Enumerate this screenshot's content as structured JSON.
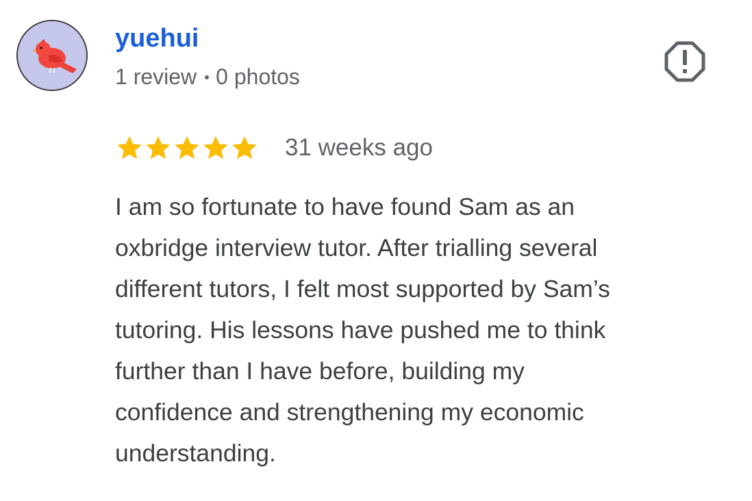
{
  "reviewer": {
    "name": "yuehui",
    "review_count": "1 review",
    "photo_count": "0 photos",
    "avatar": "red-bird-avatar"
  },
  "report": {
    "icon": "report-flag-icon",
    "color": "#5f6368"
  },
  "rating": {
    "stars": 5,
    "max": 5,
    "color": "#fbbc04",
    "timestamp": "31 weeks ago"
  },
  "review": {
    "lines": [
      "I am so fortunate to have found Sam as an",
      "oxbridge interview tutor. After trialling several",
      "different tutors, I felt most supported by Sam’s",
      "tutoring. His lessons have pushed me to think",
      "further than I have before, building my",
      "confidence and strengthening my economic",
      "understanding."
    ]
  },
  "colors": {
    "name": "#1a5fd9",
    "text": "#3c4043",
    "meta": "#5f6368",
    "avatar_bg": "#c5c8ea"
  }
}
